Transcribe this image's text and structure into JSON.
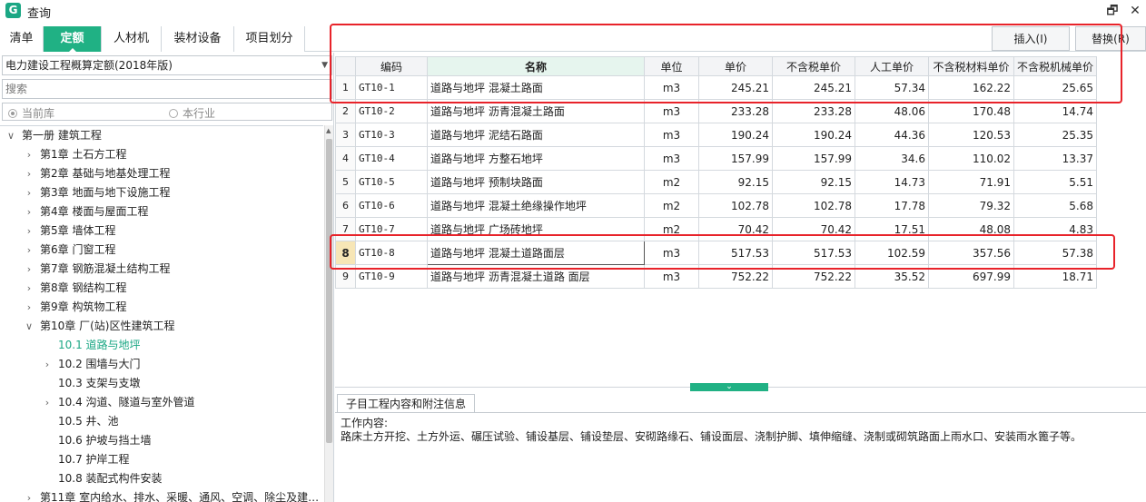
{
  "window": {
    "app_icon": "G",
    "title": "查询",
    "restore_icon": "🗗",
    "close_icon": "✕"
  },
  "tabs": [
    {
      "label": "清单",
      "active": false
    },
    {
      "label": "定额",
      "active": true
    },
    {
      "label": "人材机",
      "active": false
    },
    {
      "label": "装材设备",
      "active": false
    },
    {
      "label": "项目划分",
      "active": false
    }
  ],
  "toolbar": {
    "insert_label": "插入(I)",
    "replace_label": "替换(R)"
  },
  "left": {
    "quota_library": "电力建设工程概算定额(2018年版)",
    "search_placeholder": "搜索",
    "radio_current": "当前库",
    "radio_industry": "本行业"
  },
  "tree": [
    {
      "label": "第一册 建筑工程",
      "level": 0,
      "expand": "expanded"
    },
    {
      "label": "第1章 土石方工程",
      "level": 1,
      "expand": "collapsed"
    },
    {
      "label": "第2章 基础与地基处理工程",
      "level": 1,
      "expand": "collapsed"
    },
    {
      "label": "第3章 地面与地下设施工程",
      "level": 1,
      "expand": "collapsed"
    },
    {
      "label": "第4章 楼面与屋面工程",
      "level": 1,
      "expand": "collapsed"
    },
    {
      "label": "第5章 墙体工程",
      "level": 1,
      "expand": "collapsed"
    },
    {
      "label": "第6章 门窗工程",
      "level": 1,
      "expand": "collapsed"
    },
    {
      "label": "第7章 钢筋混凝土结构工程",
      "level": 1,
      "expand": "collapsed"
    },
    {
      "label": "第8章 钢结构工程",
      "level": 1,
      "expand": "collapsed"
    },
    {
      "label": "第9章 构筑物工程",
      "level": 1,
      "expand": "collapsed"
    },
    {
      "label": "第10章 厂(站)区性建筑工程",
      "level": 1,
      "expand": "expanded"
    },
    {
      "label": "10.1 道路与地坪",
      "level": 2,
      "expand": "none",
      "selected": true
    },
    {
      "label": "10.2 围墙与大门",
      "level": 2,
      "expand": "collapsed"
    },
    {
      "label": "10.3 支架与支墩",
      "level": 2,
      "expand": "none"
    },
    {
      "label": "10.4 沟道、隧道与室外管道",
      "level": 2,
      "expand": "collapsed"
    },
    {
      "label": "10.5 井、池",
      "level": 2,
      "expand": "none"
    },
    {
      "label": "10.6 护坡与挡土墙",
      "level": 2,
      "expand": "none"
    },
    {
      "label": "10.7 护岸工程",
      "level": 2,
      "expand": "none"
    },
    {
      "label": "10.8 装配式构件安装",
      "level": 2,
      "expand": "none"
    },
    {
      "label": "第11章 室内给水、排水、采暖、通风、空调、除尘及建…",
      "level": 1,
      "expand": "collapsed"
    }
  ],
  "grid": {
    "headers": [
      "",
      "编码",
      "名称",
      "单位",
      "单价",
      "不含税单价",
      "人工单价",
      "不含税材料单价",
      "不含税机械单价"
    ],
    "rows": [
      [
        "1",
        "GT10-1",
        "道路与地坪 混凝土路面",
        "m3",
        "245.21",
        "245.21",
        "57.34",
        "162.22",
        "25.65"
      ],
      [
        "2",
        "GT10-2",
        "道路与地坪 沥青混凝土路面",
        "m3",
        "233.28",
        "233.28",
        "48.06",
        "170.48",
        "14.74"
      ],
      [
        "3",
        "GT10-3",
        "道路与地坪 泥结石路面",
        "m3",
        "190.24",
        "190.24",
        "44.36",
        "120.53",
        "25.35"
      ],
      [
        "4",
        "GT10-4",
        "道路与地坪 方整石地坪",
        "m3",
        "157.99",
        "157.99",
        "34.6",
        "110.02",
        "13.37"
      ],
      [
        "5",
        "GT10-5",
        "道路与地坪 预制块路面",
        "m2",
        "92.15",
        "92.15",
        "14.73",
        "71.91",
        "5.51"
      ],
      [
        "6",
        "GT10-6",
        "道路与地坪 混凝土绝缘操作地坪",
        "m2",
        "102.78",
        "102.78",
        "17.78",
        "79.32",
        "5.68"
      ],
      [
        "7",
        "GT10-7",
        "道路与地坪 广场砖地坪",
        "m2",
        "70.42",
        "70.42",
        "17.51",
        "48.08",
        "4.83"
      ],
      [
        "8",
        "GT10-8",
        "道路与地坪 混凝土道路面层",
        "m3",
        "517.53",
        "517.53",
        "102.59",
        "357.56",
        "57.38"
      ],
      [
        "9",
        "GT10-9",
        "道路与地坪 沥青混凝土道路 面层",
        "m3",
        "752.22",
        "752.22",
        "35.52",
        "697.99",
        "18.71"
      ]
    ],
    "current_row": 8
  },
  "splitter_icon": "⌄",
  "info": {
    "tab_label": "子目工程内容和附注信息",
    "heading": "工作内容:",
    "content": "路床土方开挖、土方外运、碾压试验、铺设基层、铺设垫层、安砌路缘石、铺设面层、浇制护脚、填伸缩缝、浇制或砌筑路面上雨水口、安装雨水篦子等。"
  },
  "colors": {
    "accent": "#20b184",
    "highlight_box": "#e8232a",
    "selected_row": "#f7e6b6"
  }
}
